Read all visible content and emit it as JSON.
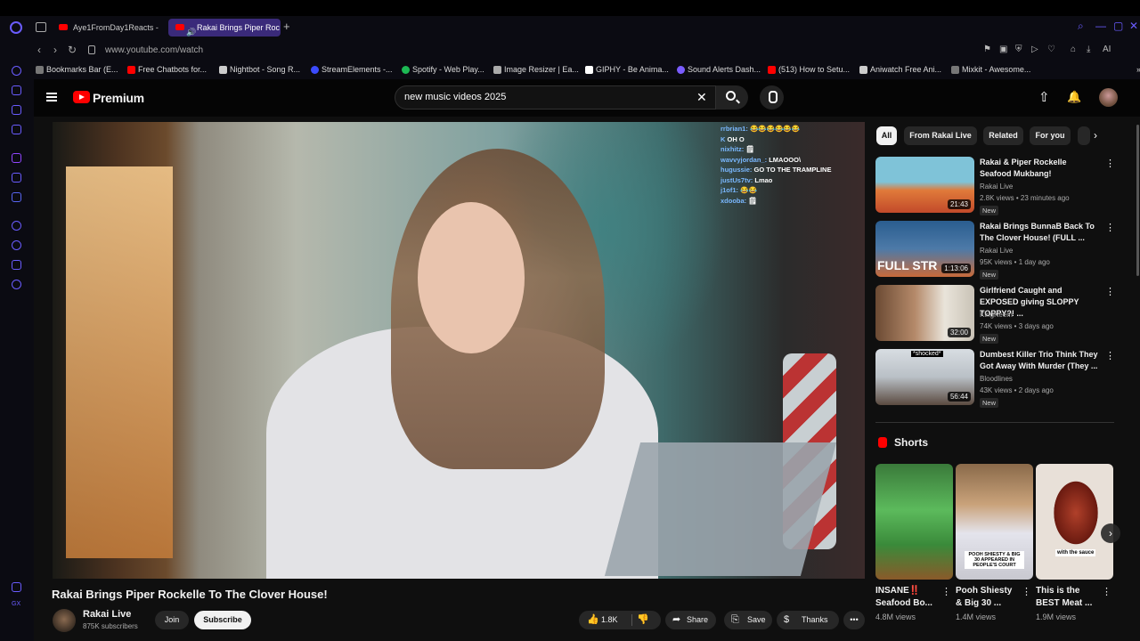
{
  "browser": {
    "tabs": [
      {
        "label": "Aye1FromDay1Reacts - Yo"
      },
      {
        "label": "Rakai Brings Piper Roc"
      }
    ],
    "url": "www.youtube.com/watch",
    "ai_label": "AI",
    "bookmarks": [
      {
        "label": "Bookmarks Bar (E...",
        "color": "#777"
      },
      {
        "label": "Free Chatbots for...",
        "color": "#f00"
      },
      {
        "label": "Nightbot - Song R...",
        "color": "#ccc"
      },
      {
        "label": "StreamElements -...",
        "color": "#3b4bff"
      },
      {
        "label": "Spotify - Web Play...",
        "color": "#1db954"
      },
      {
        "label": "Image Resizer | Ea...",
        "color": "#aaa"
      },
      {
        "label": "GIPHY - Be Anima...",
        "color": "#fff"
      },
      {
        "label": "Sound Alerts Dash...",
        "color": "#7a5cff"
      },
      {
        "label": "(513) How to Setu...",
        "color": "#f00"
      },
      {
        "label": "Aniwatch Free Ani...",
        "color": "#ccc"
      },
      {
        "label": "Mixkit - Awesome...",
        "color": "#777"
      }
    ]
  },
  "youtube": {
    "brand": "Premium",
    "search_value": "new music videos 2025",
    "video": {
      "title": "Rakai Brings Piper Rockelle To The Clover House!",
      "channel": "Rakai Live",
      "subscribers": "875K subscribers",
      "join": "Join",
      "subscribe": "Subscribe",
      "likes": "1.8K",
      "share": "Share",
      "save": "Save",
      "thanks": "Thanks",
      "more": "•••"
    },
    "chat": [
      {
        "user": "rrbrian1:",
        "msg": "😂😂😂😂😂😂"
      },
      {
        "user": "K",
        "msg": "OH O"
      },
      {
        "user": "nixhitz:",
        "msg": "🗒"
      },
      {
        "user": "wavvyjordan_:",
        "msg": "LMAOOO\\"
      },
      {
        "user": "hugussie:",
        "msg": "GO TO THE TRAMPLINE"
      },
      {
        "user": "justUs7tv:",
        "msg": "Lmao"
      },
      {
        "user": "j1of1:",
        "msg": "😂😂"
      },
      {
        "user": "xdooba:",
        "msg": "🗒"
      }
    ],
    "chips": [
      "All",
      "From Rakai Live",
      "Related",
      "For you"
    ],
    "recommendations": [
      {
        "title": "Rakai & Piper Rockelle Seafood Mukbang!",
        "channel": "Rakai Live",
        "meta": "2.8K views • 23 minutes ago",
        "badge": "New",
        "duration": "21:43"
      },
      {
        "title": "Rakai Brings BunnaB Back To The Clover House! (FULL ...",
        "channel": "Rakai Live",
        "meta": "95K views • 1 day ago",
        "badge": "New",
        "duration": "1:13:06",
        "thumb_text": "FULL STR"
      },
      {
        "title": "Girlfriend Caught and EXPOSED giving SLOPPY TOPPY?! ...",
        "channel": "KingKeem",
        "meta": "74K views • 3 days ago",
        "badge": "New",
        "duration": "32:00"
      },
      {
        "title": "Dumbest Killer Trio Think They Got Away With Murder (They ...",
        "channel": "Bloodlines",
        "meta": "43K views • 2 days ago",
        "badge": "New",
        "duration": "56:44",
        "thumb_text": "*shocked*"
      }
    ],
    "shorts_title": "Shorts",
    "shorts": [
      {
        "title": "INSANE‼️ Seafood Bo...",
        "views": "4.8M views"
      },
      {
        "title": "Pooh Shiesty & Big 30 ...",
        "views": "1.4M views",
        "caption": "POOH SHIESTY & BIG 30 APPEARED IN PEOPLE'S COURT"
      },
      {
        "title": "This is the BEST Meat ...",
        "views": "1.9M views",
        "caption": "with the sauce"
      }
    ]
  }
}
